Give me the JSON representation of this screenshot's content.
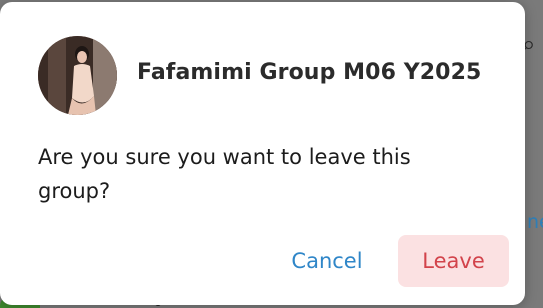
{
  "dialog": {
    "group_name": "Fafamimi Group M06 Y2025",
    "message": "Are you sure you want to leave this group?",
    "cancel_label": "Cancel",
    "leave_label": "Leave"
  },
  "background": {
    "search_icon": "search-icon",
    "link_fragment": "ne"
  },
  "colors": {
    "accent": "#2f86c8",
    "danger": "#d2434b",
    "danger_bg": "#fbe1e2"
  }
}
